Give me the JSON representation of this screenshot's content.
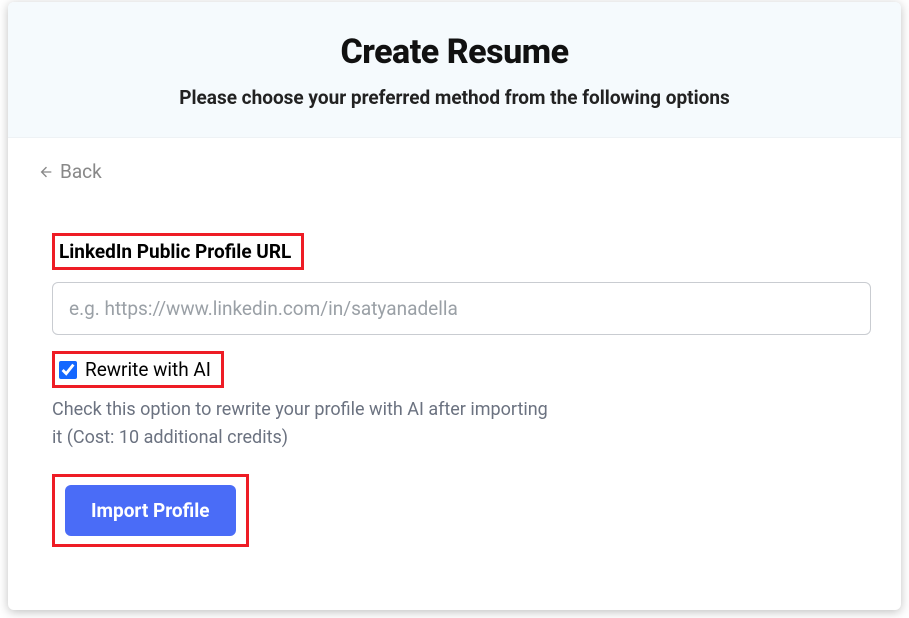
{
  "header": {
    "title": "Create Resume",
    "subtitle": "Please choose your preferred method from the following options"
  },
  "back": {
    "label": "Back"
  },
  "form": {
    "url_label": "LinkedIn Public Profile URL",
    "url_placeholder": "e.g. https://www.linkedin.com/in/satyanadella",
    "url_value": "",
    "rewrite_label": "Rewrite with AI",
    "rewrite_checked": true,
    "rewrite_help": "Check this option to rewrite your profile with AI after importing it (Cost: 10 additional credits)",
    "import_button": "Import Profile"
  }
}
